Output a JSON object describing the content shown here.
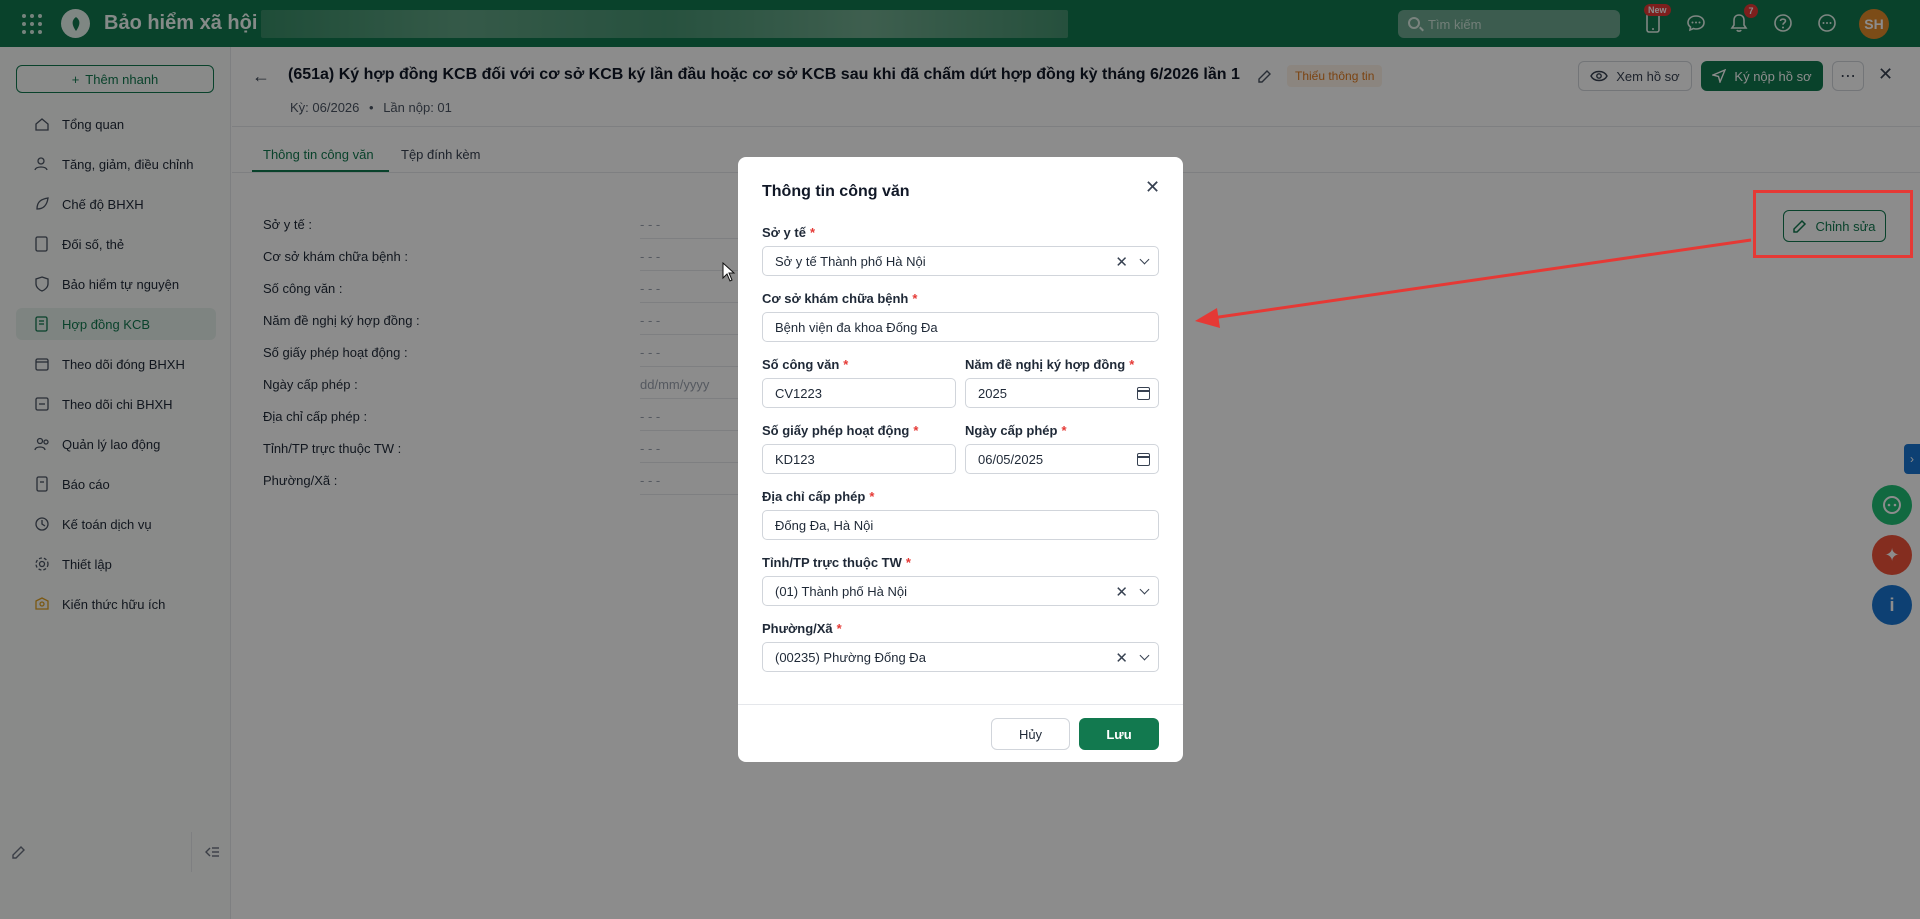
{
  "topbar": {
    "app_name": "Bảo hiểm xã hội",
    "search_placeholder": "Tìm kiếm",
    "badge_new": "New",
    "notification_count": "7",
    "avatar_initials": "SH"
  },
  "sidebar": {
    "quick_add": "Thêm nhanh",
    "items": [
      {
        "label": "Tổng quan",
        "icon": "home-icon"
      },
      {
        "label": "Tăng, giảm, điều chỉnh",
        "icon": "user-adjust-icon"
      },
      {
        "label": "Chế độ BHXH",
        "icon": "leaf-icon"
      },
      {
        "label": "Đối số, thẻ",
        "icon": "card-icon"
      },
      {
        "label": "Bảo hiểm tự nguyện",
        "icon": "shield-icon"
      },
      {
        "label": "Hợp đồng KCB",
        "icon": "contract-icon",
        "active": true
      },
      {
        "label": "Theo dõi đóng BHXH",
        "icon": "calendar-icon"
      },
      {
        "label": "Theo dõi chi BHXH",
        "icon": "payment-icon"
      },
      {
        "label": "Quản lý lao động",
        "icon": "users-icon"
      },
      {
        "label": "Báo cáo",
        "icon": "report-icon"
      },
      {
        "label": "Kế toán dịch vụ",
        "icon": "accounting-icon"
      },
      {
        "label": "Thiết lập",
        "icon": "settings-icon"
      },
      {
        "label": "Kiến thức hữu ích",
        "icon": "knowledge-icon"
      }
    ]
  },
  "header": {
    "title": "(651a) Ký hợp đồng KCB đối với cơ sở KCB ký lần đầu hoặc cơ sở KCB sau khi đã chấm dứt hợp đồng kỳ tháng 6/2026 lần 1",
    "status": "Thiếu thông tin",
    "period": "Kỳ: 06/2026",
    "submission": "Lần nộp: 01",
    "view_button": "Xem hồ sơ",
    "sign_button": "Ký nộp hồ sơ"
  },
  "tabs": [
    {
      "label": "Thông tin công văn",
      "active": true
    },
    {
      "label": "Tệp đính kèm",
      "active": false
    }
  ],
  "details": {
    "edit_button": "Chỉnh sửa",
    "fields": [
      {
        "label": "Sở y tế :",
        "value": "- - -"
      },
      {
        "label": "Cơ sở khám chữa bệnh :",
        "value": "- - -"
      },
      {
        "label": "Số công văn :",
        "value": "- - -"
      },
      {
        "label": "Năm đề nghị ký hợp đồng :",
        "value": "- - -"
      },
      {
        "label": "Số giấy phép hoạt động :",
        "value": "- - -"
      },
      {
        "label": "Ngày cấp phép :",
        "value": "dd/mm/yyyy"
      },
      {
        "label": "Địa chỉ cấp phép :",
        "value": "- - -"
      },
      {
        "label": "Tỉnh/TP trực thuộc TW :",
        "value": "- - -"
      },
      {
        "label": "Phường/Xã :",
        "value": "- - -"
      }
    ]
  },
  "modal": {
    "title": "Thông tin công văn",
    "fields": {
      "so_y_te": {
        "label": "Sở y tế",
        "value": "Sở y tế Thành phố Hà Nội"
      },
      "co_so": {
        "label": "Cơ sở khám chữa bệnh",
        "value": "Bệnh viện đa khoa Đống Đa"
      },
      "so_cong_van": {
        "label": "Số công văn",
        "value": "CV1223"
      },
      "nam_de_nghi": {
        "label": "Năm đề nghị ký hợp đồng",
        "value": "2025"
      },
      "so_giay_phep": {
        "label": "Số giấy phép hoạt động",
        "value": "KD123"
      },
      "ngay_cap_phep": {
        "label": "Ngày cấp phép",
        "value": "06/05/2025"
      },
      "dia_chi": {
        "label": "Địa chỉ cấp phép",
        "value": "Đống Đa, Hà Nội"
      },
      "tinh_tp": {
        "label": "Tỉnh/TP trực thuộc TW",
        "value": "(01) Thành phố Hà Nội"
      },
      "phuong_xa": {
        "label": "Phường/Xã",
        "value": "(00235) Phường Đống Đa"
      }
    },
    "cancel": "Hủy",
    "save": "Lưu"
  },
  "colors": {
    "primary": "#12794f",
    "warning": "#e07a1f",
    "annotation": "#e53935"
  }
}
